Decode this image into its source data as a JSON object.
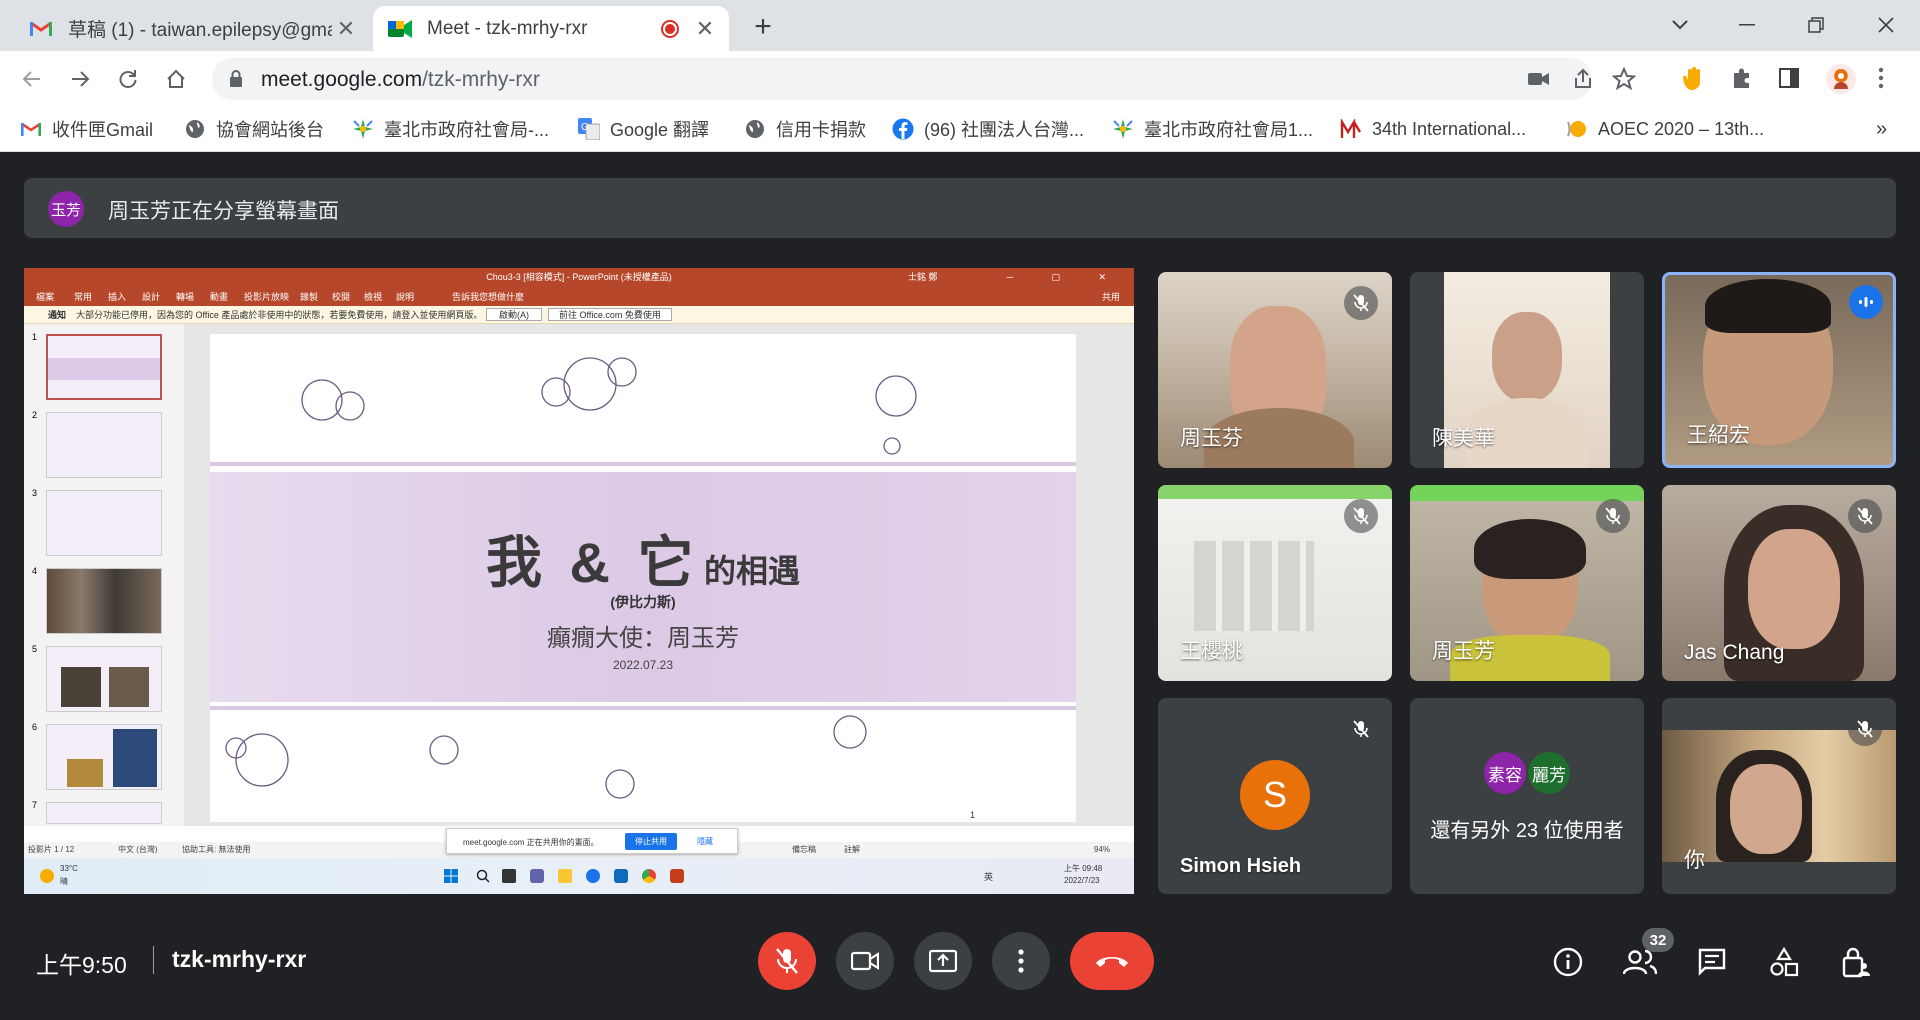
{
  "browser": {
    "tabs": [
      {
        "title": "草稿 (1) - taiwan.epilepsy@gma",
        "favicon": "gmail-icon",
        "active": false
      },
      {
        "title": "Meet - tzk-mrhy-rxr",
        "favicon": "meet-icon",
        "active": true,
        "recording": true
      }
    ],
    "url_host": "meet.google.com",
    "url_path": "/tzk-mrhy-rxr",
    "bookmarks": [
      {
        "label": "收件匣Gmail",
        "icon": "gmail-icon"
      },
      {
        "label": "協會網站後台",
        "icon": "globe-icon"
      },
      {
        "label": "臺北市政府社會局-...",
        "icon": "taipei-icon"
      },
      {
        "label": "Google 翻譯",
        "icon": "translate-icon"
      },
      {
        "label": "信用卡捐款",
        "icon": "globe-icon"
      },
      {
        "label": "(96) 社團法人台灣...",
        "icon": "facebook-icon"
      },
      {
        "label": "臺北市政府社會局1...",
        "icon": "taipei-icon"
      },
      {
        "label": "34th International...",
        "icon": "m-logo-icon"
      },
      {
        "label": "AOEC 2020 – 13th...",
        "icon": "aoec-icon"
      }
    ]
  },
  "meet": {
    "presenter_initials": "玉芳",
    "presenter_banner": "周玉芳正在分享螢幕畫面",
    "participants": [
      {
        "name": "周玉芬",
        "muted": true
      },
      {
        "name": "陳美華",
        "muted": false
      },
      {
        "name": "王紹宏",
        "muted": false,
        "speaking": true
      },
      {
        "name": "王櫻桃",
        "muted": true
      },
      {
        "name": "周玉芳",
        "muted": true
      },
      {
        "name": "Jas Chang",
        "muted": true
      },
      {
        "name": "Simon Hsieh",
        "muted": true,
        "avatar_letter": "S"
      },
      {
        "name": "你",
        "muted": true
      }
    ],
    "others": {
      "avatars": [
        "素容",
        "麗芳"
      ],
      "label": "還有另外 23 位使用者"
    },
    "time": "上午9:50",
    "meeting_code": "tzk-mrhy-rxr",
    "people_count": "32"
  },
  "shared_screen": {
    "pp_title": "Chou3-3 [相容模式] - PowerPoint (未授權產品)",
    "pp_user": "士銘 鄭",
    "ribbon_tabs": [
      "檔案",
      "常用",
      "插入",
      "設計",
      "轉場",
      "動畫",
      "投影片放映",
      "錄製",
      "校閱",
      "檢視",
      "說明",
      "告訴我您想做什麼"
    ],
    "share_label": "共用",
    "notice": "大部分功能已停用，因為您的 Office 產品處於非使用中的狀態，若要免費使用，請登入並使用網頁版。",
    "notice_label": "通知",
    "notice_btn1": "啟動(A)",
    "notice_btn2": "前往 Office.com 免費使用",
    "slide_title_main": "我 & 它",
    "slide_title_suffix": "的相遇",
    "slide_subtitle": "(伊比力斯)",
    "slide_author": "癲癇大使：周玉芳",
    "slide_date": "2022.07.23",
    "slide_page_num": "1",
    "thumb_numbers": [
      "1",
      "2",
      "3",
      "4",
      "5",
      "6",
      "7"
    ],
    "status_left": "投影片 1 / 12",
    "status_lang": "中文 (台灣)",
    "status_access": "協助工具: 無法使用",
    "status_notes": "備忘稿",
    "status_comments": "註解",
    "zoom": "94%",
    "share_bar_text": "meet.google.com 正在共用你的畫面。",
    "share_stop": "停止共用",
    "share_hide": "隱藏",
    "weather_temp": "33°C",
    "weather_desc": "晴",
    "tray_lang": "英",
    "tray_time": "上午 09:48",
    "tray_date": "2022/7/23"
  },
  "colors": {
    "end_call": "#ea4335",
    "mic_off_red": "#ea4335",
    "speaking_border": "#8ab4f8",
    "pp_red": "#b7472a",
    "simon_avatar": "#e8710a"
  }
}
